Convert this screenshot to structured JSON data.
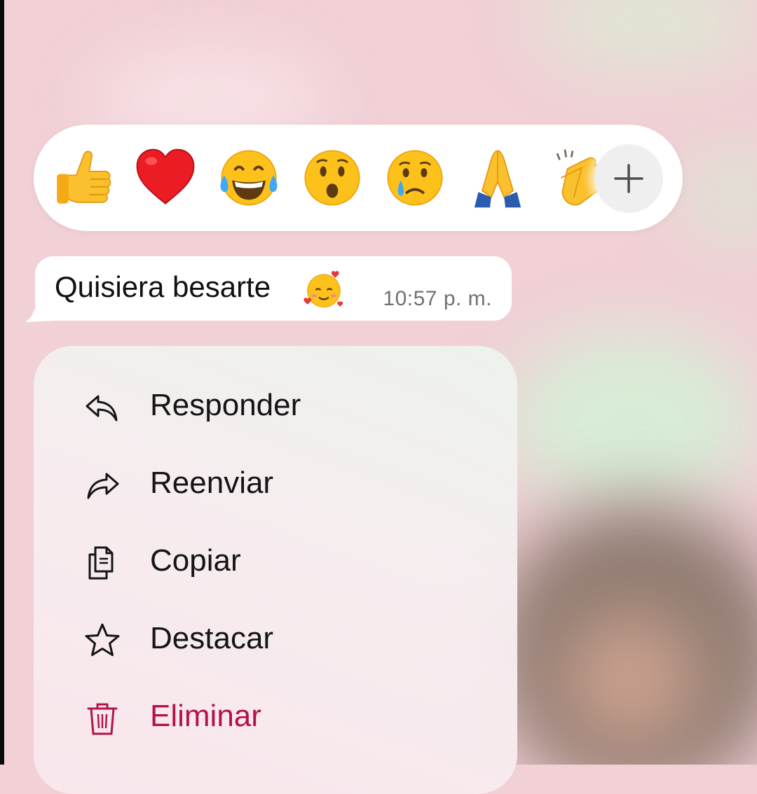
{
  "reactions": {
    "items": [
      {
        "name": "thumbs-up",
        "glyph": "👍"
      },
      {
        "name": "red-heart",
        "glyph": "❤️"
      },
      {
        "name": "tears-of-joy",
        "glyph": "😂"
      },
      {
        "name": "surprised",
        "glyph": "😮"
      },
      {
        "name": "crying",
        "glyph": "😢"
      },
      {
        "name": "folded-hands",
        "glyph": "🙏"
      },
      {
        "name": "clapping-hands",
        "glyph": "👏"
      }
    ],
    "more_icon": "plus-icon"
  },
  "message": {
    "text": "Quisiera besarte",
    "emoji": "🥰",
    "time": "10:57 p. m."
  },
  "menu": {
    "items": [
      {
        "label": "Responder",
        "icon": "reply-icon"
      },
      {
        "label": "Reenviar",
        "icon": "forward-icon"
      },
      {
        "label": "Copiar",
        "icon": "copy-icon"
      },
      {
        "label": "Destacar",
        "icon": "star-icon"
      },
      {
        "label": "Eliminar",
        "icon": "trash-icon",
        "danger_color": "#b3134a"
      }
    ]
  },
  "colors": {
    "background": "#f1d0d6",
    "bubble": "#ffffff",
    "danger": "#b3134a"
  }
}
